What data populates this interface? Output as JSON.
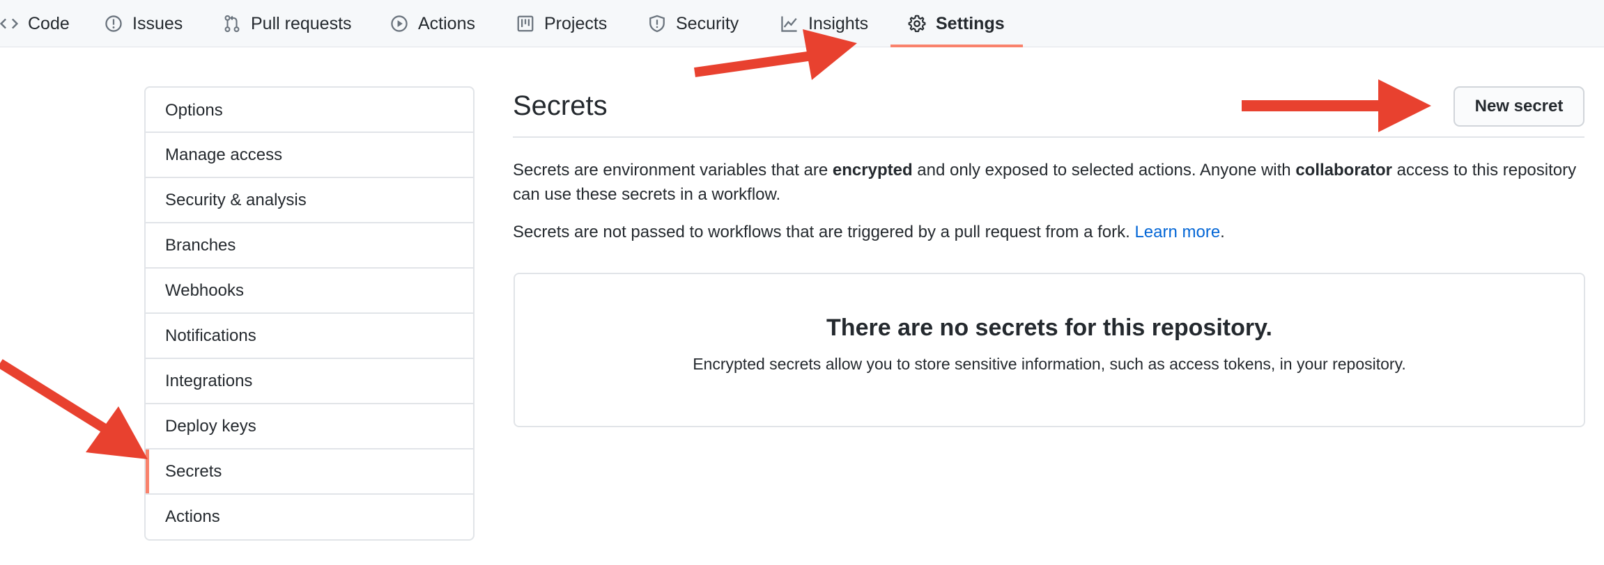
{
  "repo_nav": {
    "tabs": [
      {
        "label": "Code",
        "icon": "code-icon"
      },
      {
        "label": "Issues",
        "icon": "issue-opened-icon"
      },
      {
        "label": "Pull requests",
        "icon": "git-pull-request-icon"
      },
      {
        "label": "Actions",
        "icon": "play-icon"
      },
      {
        "label": "Projects",
        "icon": "project-icon"
      },
      {
        "label": "Security",
        "icon": "shield-icon"
      },
      {
        "label": "Insights",
        "icon": "graph-icon"
      },
      {
        "label": "Settings",
        "icon": "gear-icon",
        "active": true
      }
    ]
  },
  "sidebar": {
    "items": [
      {
        "label": "Options"
      },
      {
        "label": "Manage access"
      },
      {
        "label": "Security & analysis"
      },
      {
        "label": "Branches"
      },
      {
        "label": "Webhooks"
      },
      {
        "label": "Notifications"
      },
      {
        "label": "Integrations"
      },
      {
        "label": "Deploy keys"
      },
      {
        "label": "Secrets",
        "selected": true
      },
      {
        "label": "Actions"
      }
    ]
  },
  "main": {
    "title": "Secrets",
    "new_secret_label": "New secret",
    "description_1": {
      "part1": "Secrets are environment variables that are ",
      "bold1": "encrypted",
      "part2": " and only exposed to selected actions. Anyone with ",
      "bold2": "collaborator",
      "part3": " access to this repository can use these secrets in a workflow."
    },
    "description_2": {
      "text": "Secrets are not passed to workflows that are triggered by a pull request from a fork. ",
      "link": "Learn more",
      "after": "."
    },
    "blankslate": {
      "title": "There are no secrets for this repository.",
      "description": "Encrypted secrets allow you to store sensitive information, such as access tokens, in your repository."
    }
  },
  "colors": {
    "annotation_arrow": "#e8412f",
    "active_tab_underline": "#f9826c",
    "link": "#0366d6"
  }
}
